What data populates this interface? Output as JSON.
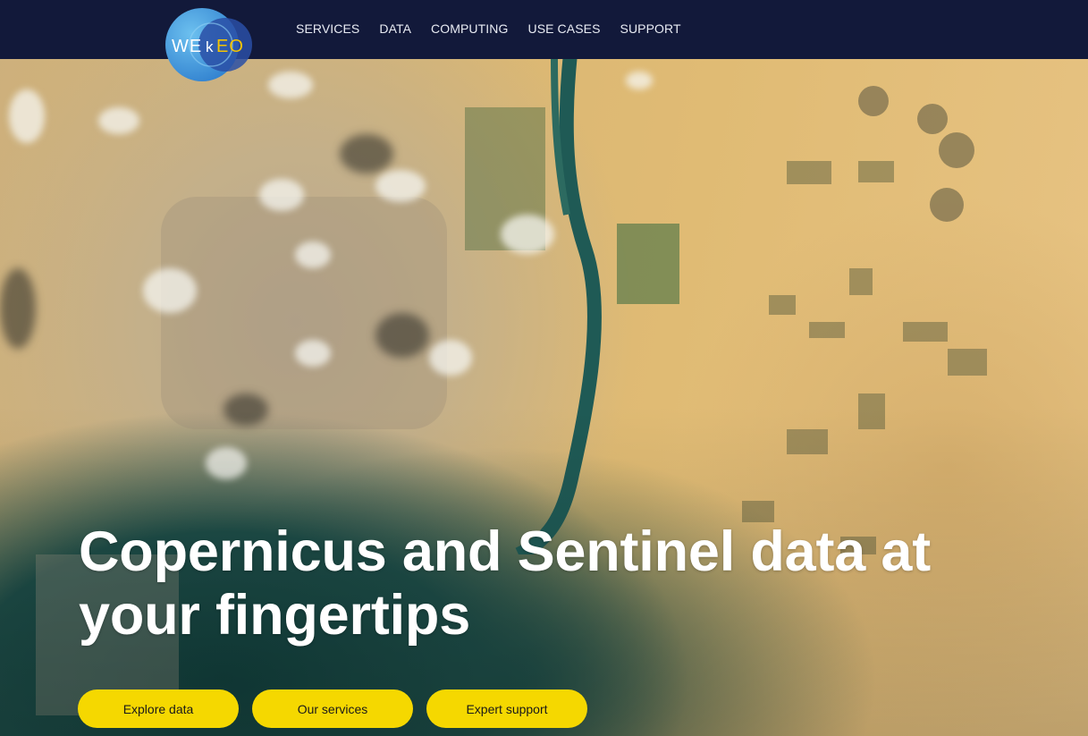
{
  "brand": {
    "logo_text_we": "WE",
    "logo_text_k": "k",
    "logo_text_eo": "EO"
  },
  "nav": {
    "items": [
      {
        "label": "SERVICES"
      },
      {
        "label": "DATA"
      },
      {
        "label": "COMPUTING"
      },
      {
        "label": "USE CASES"
      },
      {
        "label": "SUPPORT"
      }
    ]
  },
  "hero": {
    "headline": "Copernicus and Sentinel data at your fingertips",
    "buttons": [
      {
        "label": "Explore data"
      },
      {
        "label": "Our services"
      },
      {
        "label": "Expert support"
      }
    ]
  },
  "colors": {
    "nav_background": "#12193a",
    "cta_background": "#f5d800",
    "logo_blue": "#3a8fd4"
  }
}
